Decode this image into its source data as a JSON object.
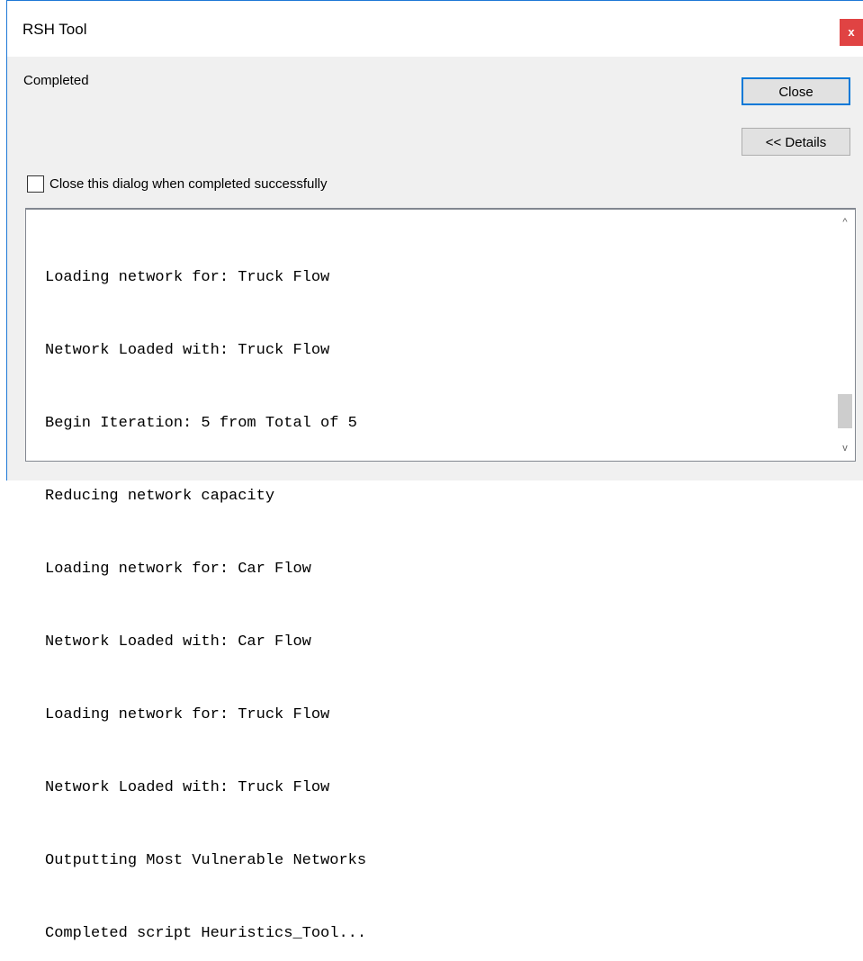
{
  "window": {
    "title": "RSH Tool",
    "close_glyph": "x"
  },
  "status": {
    "text": "Completed"
  },
  "buttons": {
    "close_label": "Close",
    "details_label": "<< Details"
  },
  "checkbox": {
    "label": "Close this dialog when completed successfully",
    "checked": false
  },
  "log": {
    "lines": [
      "Loading network for: Truck Flow",
      "Network Loaded with: Truck Flow",
      "Begin Iteration: 5 from Total of 5",
      "Reducing network capacity",
      "Loading network for: Car Flow",
      "Network Loaded with: Car Flow",
      "Loading network for: Truck Flow",
      "Network Loaded with: Truck Flow",
      "Outputting Most Vulnerable Networks",
      "Completed script Heuristics_Tool..."
    ]
  },
  "scrollbar": {
    "up_icon": "chevron-up-icon",
    "down_icon": "chevron-down-icon",
    "up_glyph": "^",
    "down_glyph": "v"
  }
}
